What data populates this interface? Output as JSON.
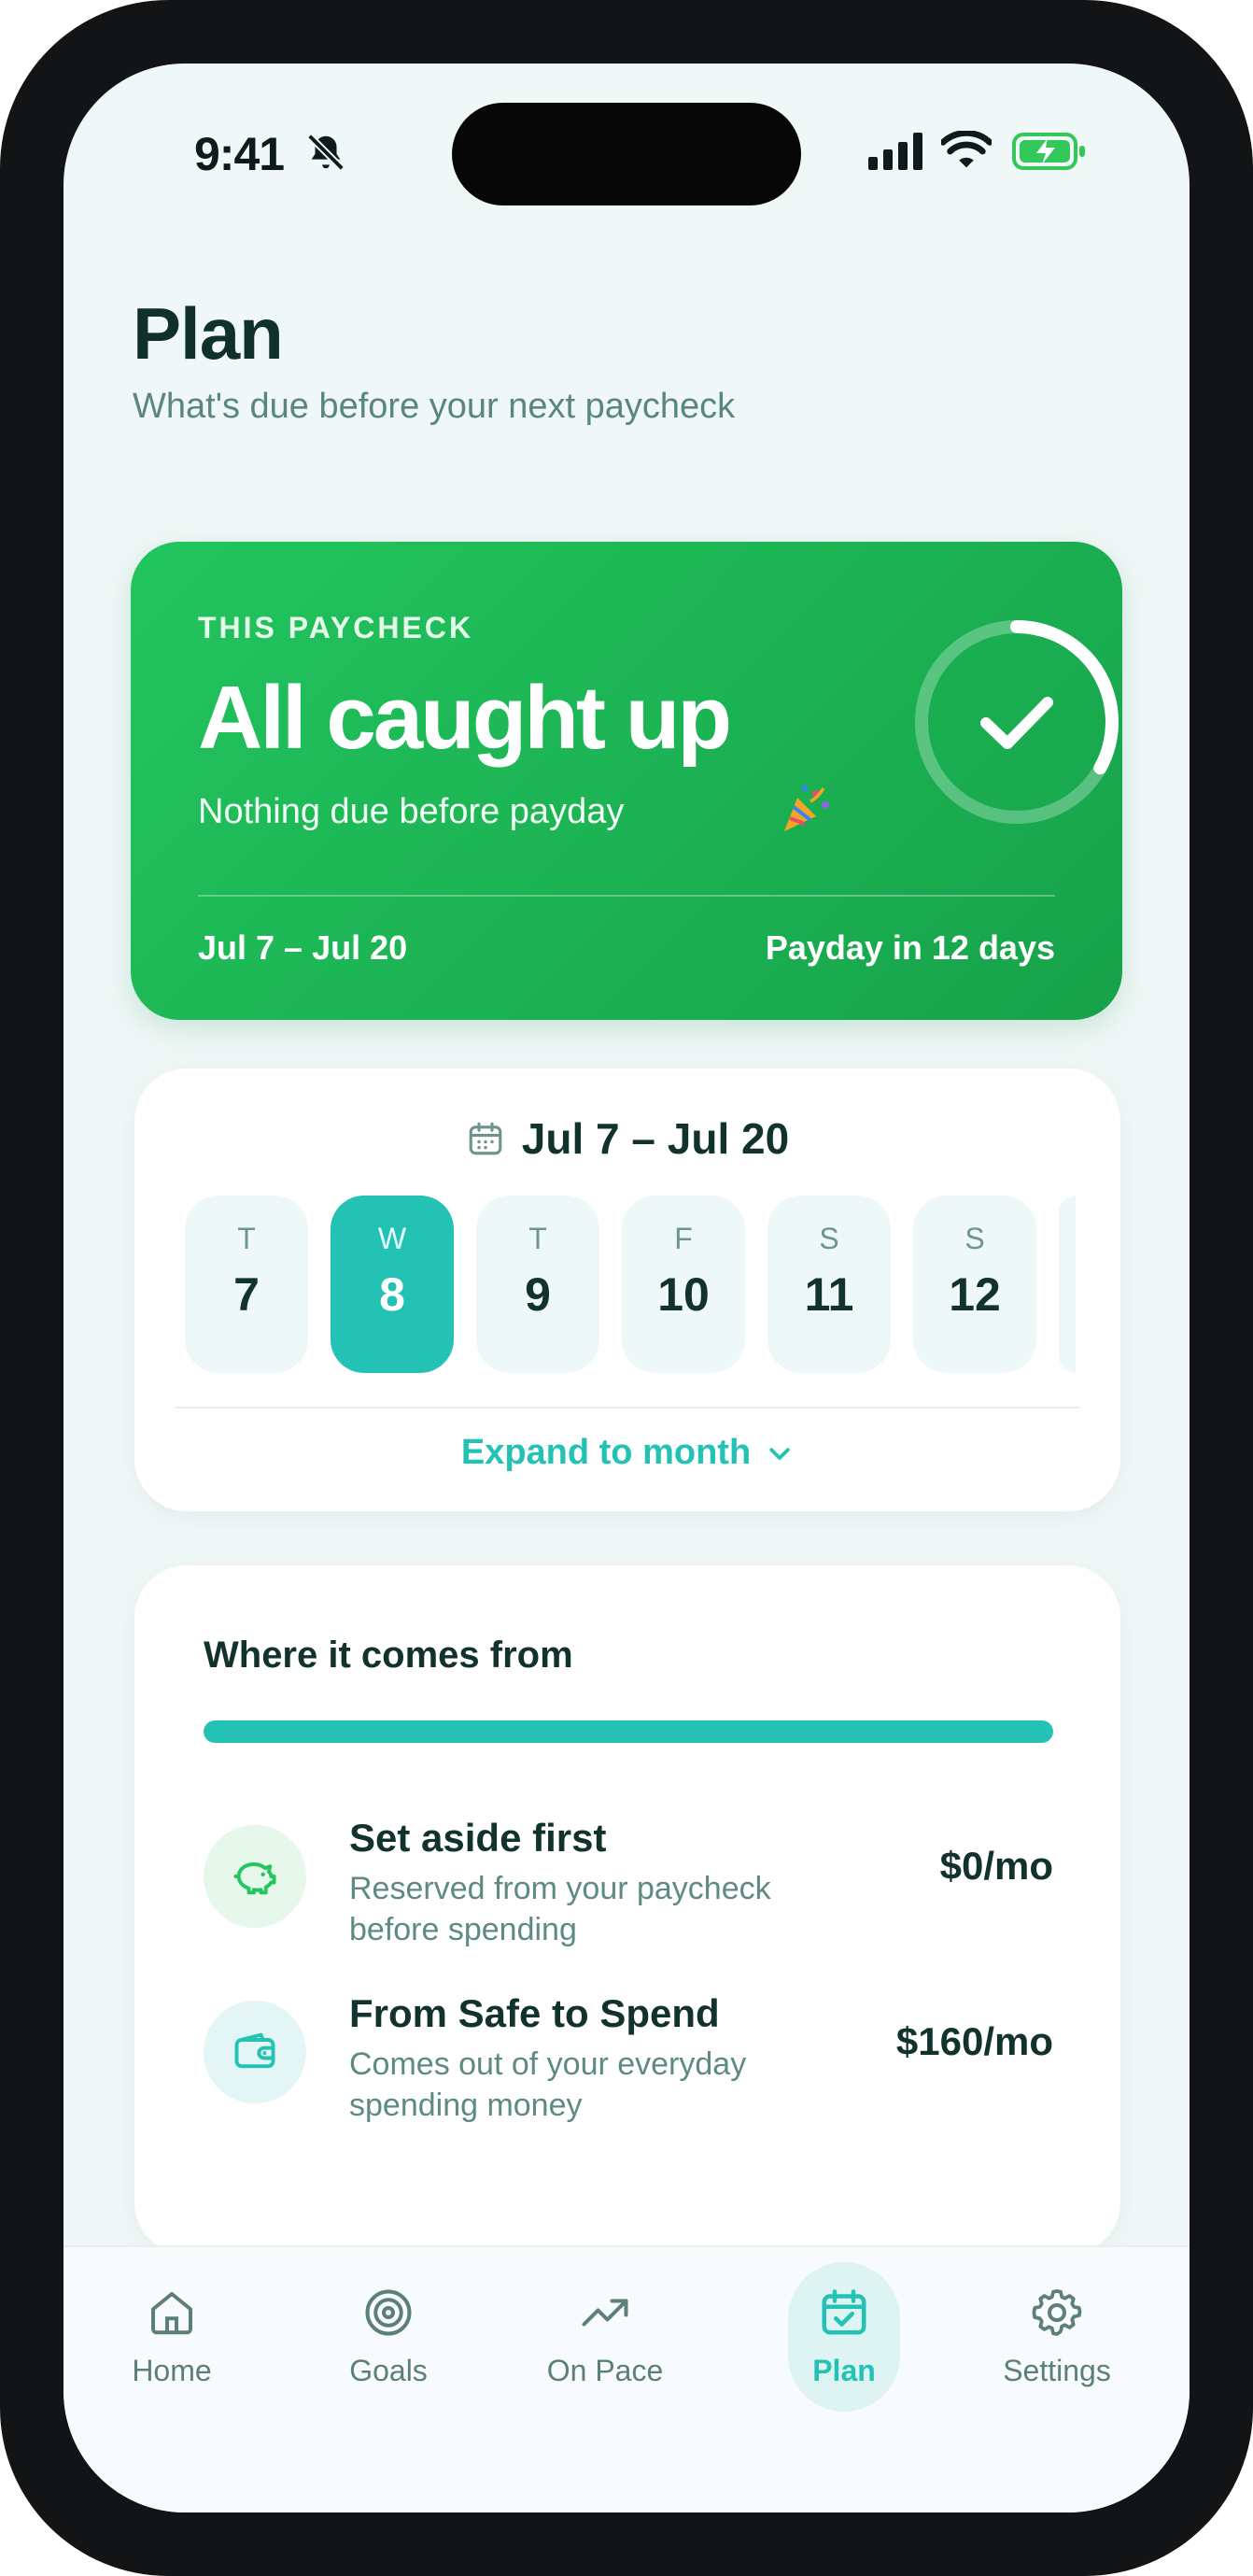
{
  "status_bar": {
    "time": "9:41"
  },
  "header": {
    "title": "Plan",
    "subtitle": "What's due before your next paycheck"
  },
  "hero": {
    "eyebrow": "THIS PAYCHECK",
    "title": "All caught up",
    "subtitle": "Nothing due before payday",
    "emoji": "party-popper",
    "date_range": "Jul 7 – Jul 20",
    "payday_text": "Payday in 12 days",
    "ring_progress_fraction": 0.33,
    "color": "#22c55e"
  },
  "calendar": {
    "range": "Jul 7 – Jul 20",
    "days": [
      {
        "dow": "T",
        "num": "7"
      },
      {
        "dow": "W",
        "num": "8",
        "selected": true
      },
      {
        "dow": "T",
        "num": "9"
      },
      {
        "dow": "F",
        "num": "10"
      },
      {
        "dow": "S",
        "num": "11"
      },
      {
        "dow": "S",
        "num": "12"
      }
    ],
    "expand_label": "Expand to month",
    "accent": "#24c1b5"
  },
  "sources": {
    "title": "Where it comes from",
    "bar_fill_fraction": 1.0,
    "rows": [
      {
        "icon": "piggy-bank-icon",
        "name": "Set aside first",
        "desc": "Reserved from your paycheck before spending",
        "amount": "$0/mo"
      },
      {
        "icon": "wallet-icon",
        "name": "From Safe to Spend",
        "desc": "Comes out of your everyday spending money",
        "amount": "$160/mo"
      }
    ]
  },
  "tabs": [
    {
      "label": "Home",
      "icon": "home-icon"
    },
    {
      "label": "Goals",
      "icon": "target-icon"
    },
    {
      "label": "On Pace",
      "icon": "trend-up-icon"
    },
    {
      "label": "Plan",
      "icon": "calendar-check-icon",
      "active": true
    },
    {
      "label": "Settings",
      "icon": "gear-icon"
    }
  ]
}
